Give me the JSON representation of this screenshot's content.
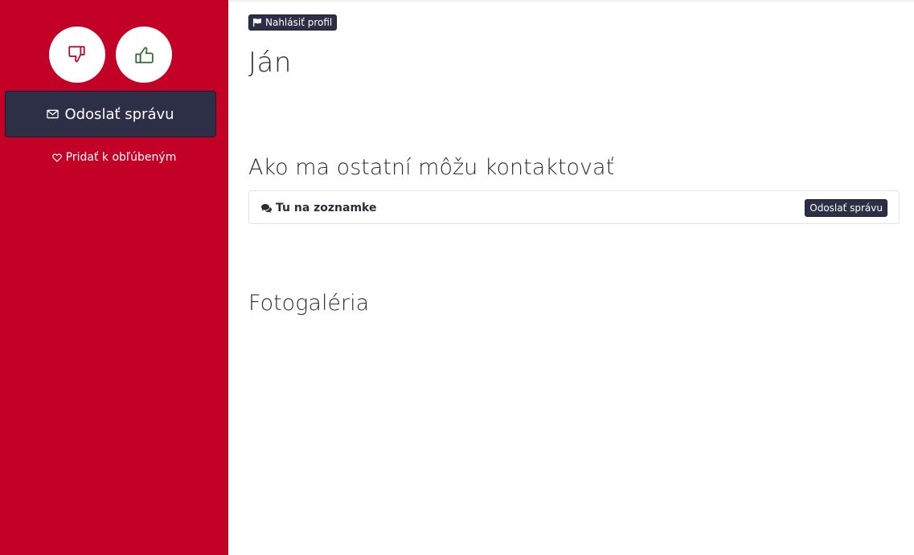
{
  "sidebar": {
    "dislike_icon": "thumbs-down-icon",
    "like_icon": "thumbs-up-icon",
    "send_message_label": "Odoslať správu",
    "favorite_label": "Pridať k obľúbeným",
    "background_color": "#c30026"
  },
  "main": {
    "report_label": "Nahlásiť profil",
    "profile_name": "Ján",
    "contact_section_title": "Ako ma ostatní môžu kontaktovať",
    "contact_method_label": "Tu na zoznamke",
    "contact_send_label": "Odoslať správu",
    "gallery_section_title": "Fotogaléria"
  },
  "colors": {
    "accent_dark": "#2c2f45",
    "dislike_red": "#c30026",
    "like_green": "#2e6b2f"
  }
}
